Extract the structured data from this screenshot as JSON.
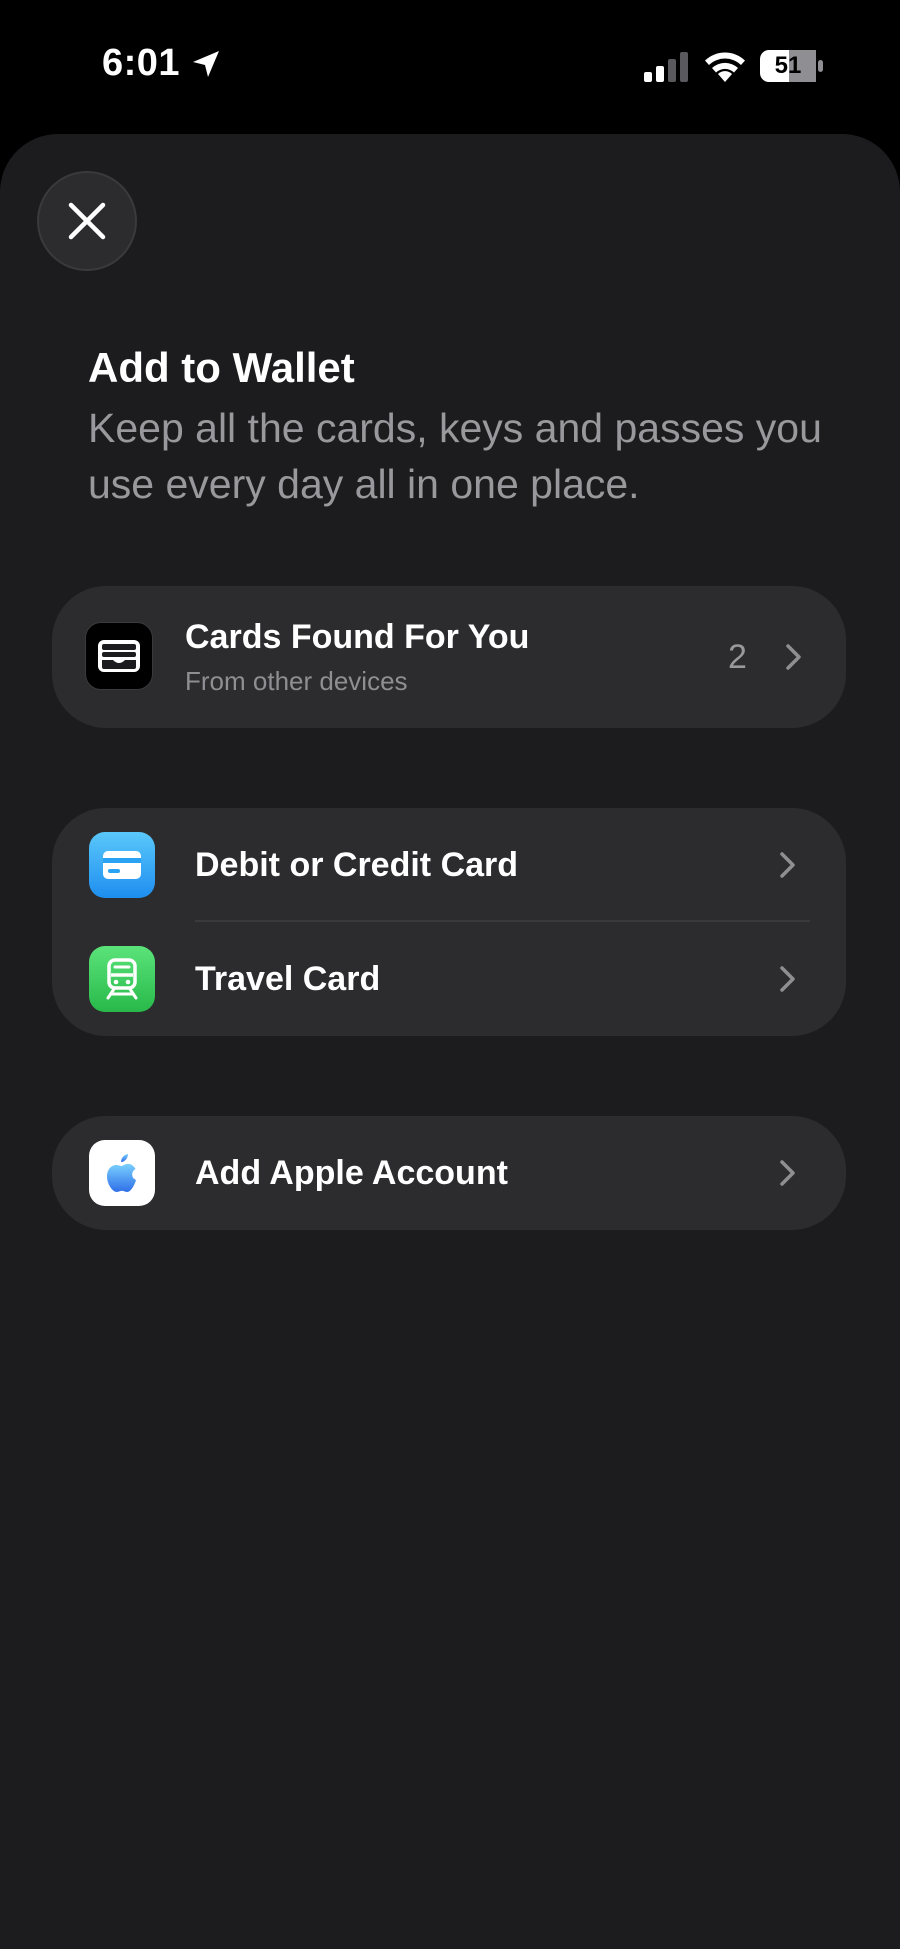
{
  "status_bar": {
    "time": "6:01",
    "battery_level": "51",
    "icons": [
      "location-arrow-icon",
      "cellular-signal-icon",
      "wifi-icon",
      "battery-icon"
    ]
  },
  "sheet": {
    "close_icon": "close-icon",
    "title": "Add to Wallet",
    "subtitle": "Keep all the cards, keys and passes you use every day all in one place."
  },
  "found_cards": {
    "icon": "wallet-icon",
    "title": "Cards Found For You",
    "subtitle": "From other devices",
    "count": "2"
  },
  "card_types": [
    {
      "icon": "credit-card-icon",
      "label": "Debit or Credit Card",
      "icon_color": "#2aa3f5"
    },
    {
      "icon": "train-icon",
      "label": "Travel Card",
      "icon_color": "#30c94e"
    }
  ],
  "apple_account": {
    "icon": "apple-logo-icon",
    "label": "Add Apple Account"
  },
  "colors": {
    "background": "#000000",
    "sheet": "#1c1c1e",
    "row": "#2c2c2e",
    "secondary_text": "#98989d"
  }
}
